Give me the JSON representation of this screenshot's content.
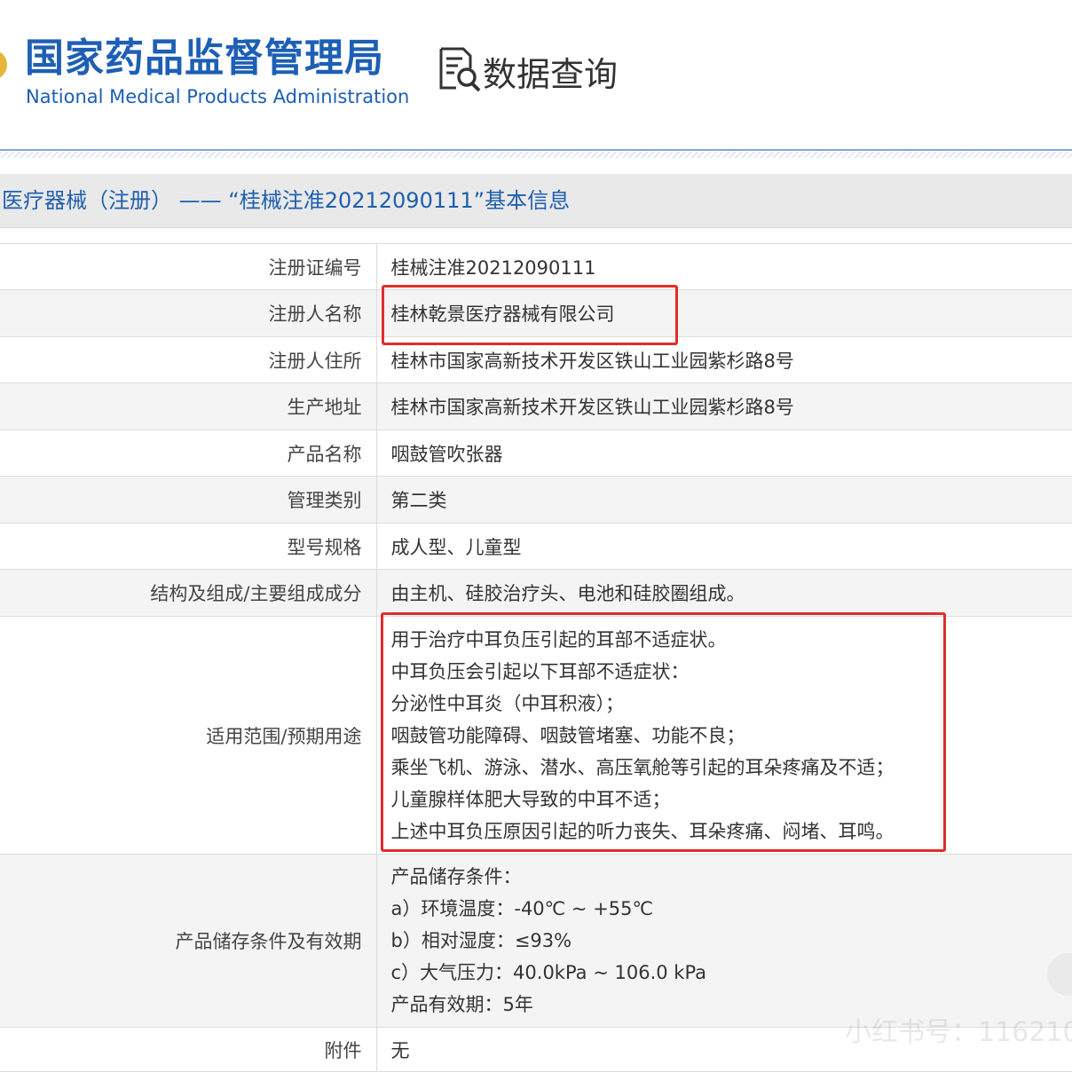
{
  "header": {
    "agency_cn": "国家药品监督管理局",
    "agency_en": "National Medical Products Administration",
    "query_label": "数据查询"
  },
  "title_bar": {
    "text": "医疗器械（注册） —— “桂械注准20212090111”基本信息"
  },
  "rows": [
    {
      "label": "注册证编号",
      "value": "桂械注准20212090111"
    },
    {
      "label": "注册人名称",
      "value": "桂林乾景医疗器械有限公司"
    },
    {
      "label": "注册人住所",
      "value": "桂林市国家高新技术开发区铁山工业园紫杉路8号"
    },
    {
      "label": "生产地址",
      "value": "桂林市国家高新技术开发区铁山工业园紫杉路8号"
    },
    {
      "label": "产品名称",
      "value": "咽鼓管吹张器"
    },
    {
      "label": "管理类别",
      "value": "第二类"
    },
    {
      "label": "型号规格",
      "value": "成人型、儿童型"
    },
    {
      "label": "结构及组成/主要组成成分",
      "value": "由主机、硅胶治疗头、电池和硅胶圈组成。"
    },
    {
      "label": "适用范围/预期用途",
      "lines": [
        "用于治疗中耳负压引起的耳部不适症状。",
        "中耳负压会引起以下耳部不适症状：",
        "分泌性中耳炎（中耳积液）；",
        "咽鼓管功能障碍、咽鼓管堵塞、功能不良；",
        "乘坐飞机、游泳、潜水、高压氧舱等引起的耳朵疼痛及不适；",
        "儿童腺样体肥大导致的中耳不适；",
        "上述中耳负压原因引起的听力丧失、耳朵疼痛、闷堵、耳鸣。"
      ]
    },
    {
      "label": "产品储存条件及有效期",
      "lines": [
        "产品储存条件：",
        "a）环境温度：-40℃ ~ +55℃",
        "b）相对湿度：≤93%",
        "c）大气压力：40.0kPa ~ 106.0 kPa",
        "产品有效期：5年"
      ]
    },
    {
      "label": "附件",
      "value": "无"
    }
  ],
  "watermark": "小红书号：116210",
  "colors": {
    "brand_blue": "#1d5fb4",
    "title_blue": "#1e5fae",
    "annotation_red": "#e02d2d",
    "title_bar_bg": "#e9e9e9",
    "alt_row_bg": "#f4f4f4"
  },
  "icons": {
    "query": "document-search-icon",
    "emblem": "national-emblem"
  }
}
